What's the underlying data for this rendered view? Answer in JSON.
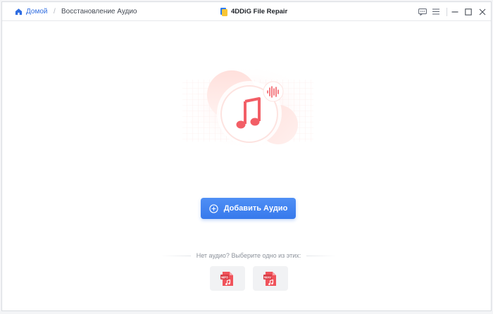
{
  "breadcrumb": {
    "home_label": "Домой",
    "separator": "/",
    "current_label": "Восстановление Аудио"
  },
  "app": {
    "title": "4DDiG File Repair"
  },
  "window_controls": [
    "feedback-icon",
    "menu-icon",
    "minimize-icon",
    "maximize-icon",
    "close-icon"
  ],
  "main": {
    "add_button_label": "Добавить Аудио",
    "hint_text": "Нет аудио? Выберите одно из этих:",
    "samples": [
      {
        "label": "MP3",
        "icon": "mp3-file-icon"
      },
      {
        "label": "WAV",
        "icon": "wav-file-icon"
      }
    ]
  },
  "colors": {
    "accent": "#3779ec",
    "link": "#2f6de1",
    "file_icon": "#f0535b",
    "hero_note": "#f25e66"
  }
}
